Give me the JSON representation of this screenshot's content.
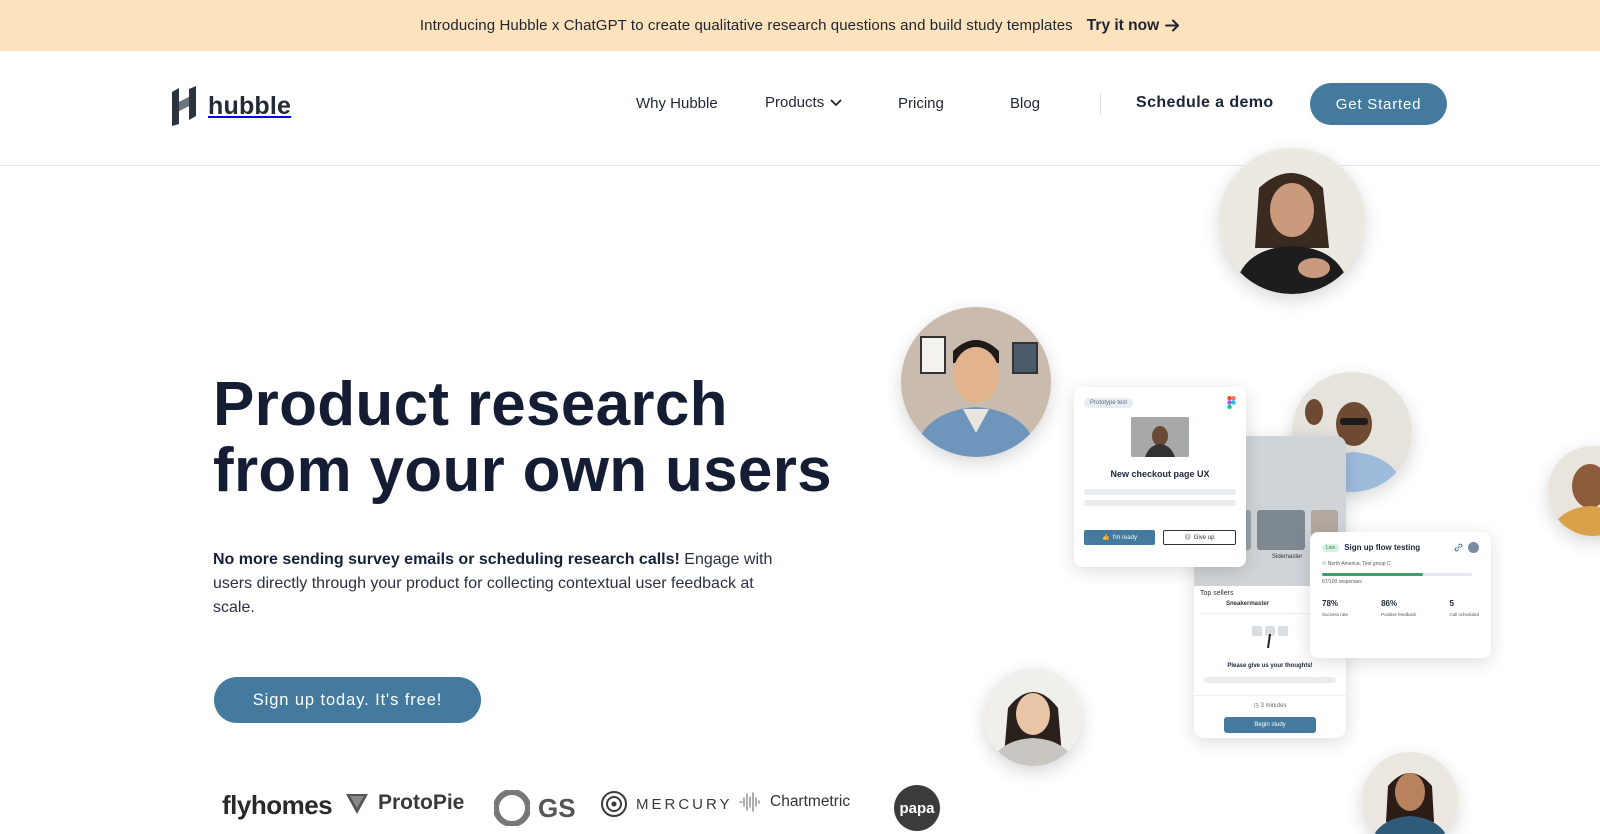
{
  "announcement": {
    "message": "Introducing Hubble x ChatGPT to create qualitative research questions and build study templates",
    "cta_label": "Try it now"
  },
  "header": {
    "logo_text": "hubble",
    "nav": {
      "why": "Why Hubble",
      "products": "Products",
      "pricing": "Pricing",
      "blog": "Blog"
    },
    "demo_label": "Schedule a demo",
    "get_started_label": "Get Started"
  },
  "hero": {
    "title_line1": "Product research",
    "title_line2": "from your own users",
    "sub_bold": "No more sending survey emails or scheduling research calls!",
    "sub_rest": " Engage with users directly through your product for collecting contextual user feedback at scale.",
    "signup_label": "Sign up today. It's free!"
  },
  "mockups": {
    "prototype_card": {
      "tag": "Prototype test",
      "title": "New checkout page UX",
      "ready_label": "I'm ready",
      "giveup_label": "Give up"
    },
    "phone": {
      "section": "Top sellers",
      "item": "Sneakermaster",
      "caption": "Sidemaster",
      "prompt": "Please give us your thoughts!",
      "duration": "3 minutes",
      "begin_label": "Begin study"
    },
    "study_card": {
      "badge": "Live",
      "title": "Sign up flow testing",
      "audience": "North America, Test group C",
      "responses": "67/100 responses",
      "progress": 0.67,
      "stats": [
        {
          "value": "78%",
          "label": "Success rate"
        },
        {
          "value": "86%",
          "label": "Positive feedback"
        },
        {
          "value": "5",
          "label": "Call scheduled"
        }
      ]
    }
  },
  "logos": [
    "flyhomes",
    "ProtoPie",
    "GS",
    "MERCURY",
    "Chartmetric",
    "papa"
  ],
  "colors": {
    "accent": "#437a9e",
    "banner": "#fde3bd",
    "heading": "#141d33"
  }
}
